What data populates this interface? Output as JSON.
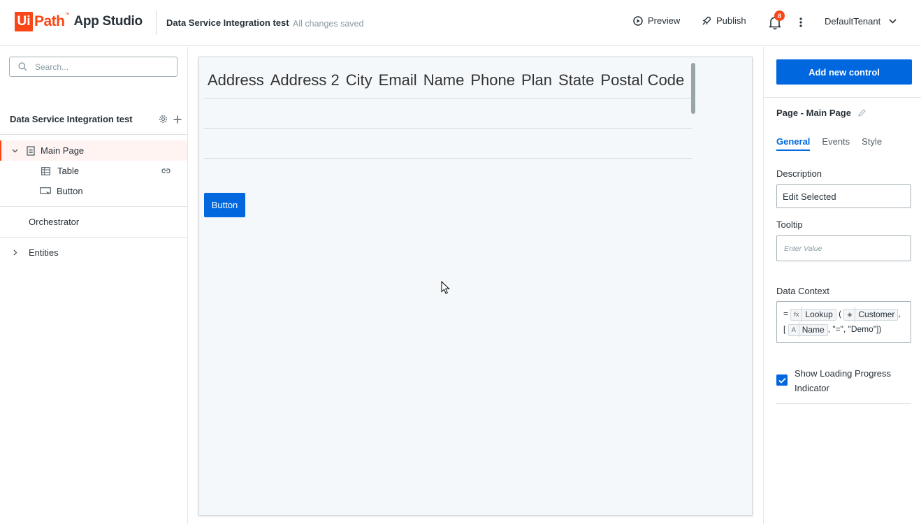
{
  "header": {
    "logo_ui": "Ui",
    "logo_path": "Path",
    "logo_tm": "™",
    "logo_app": "App Studio",
    "project_name": "Data Service Integration test",
    "save_status": "All changes saved",
    "preview_label": "Preview",
    "publish_label": "Publish",
    "notification_count": "8",
    "tenant": "DefaultTenant"
  },
  "left_panel": {
    "search_placeholder": "Search...",
    "tree_title": "Data Service Integration test",
    "items": [
      {
        "label": "Main Page",
        "icon": "page-icon",
        "selected": true
      },
      {
        "label": "Table",
        "icon": "table-icon"
      },
      {
        "label": "Button",
        "icon": "button-control-icon"
      }
    ],
    "orchestrator_label": "Orchestrator",
    "entities_label": "Entities"
  },
  "canvas": {
    "columns": [
      "Address",
      "Address 2",
      "City",
      "Email",
      "Name",
      "Phone",
      "Plan",
      "State",
      "Postal Code"
    ],
    "button_label": "Button"
  },
  "right_panel": {
    "add_control_label": "Add new control",
    "page_title": "Page - Main Page",
    "tabs": [
      "General",
      "Events",
      "Style"
    ],
    "active_tab": "General",
    "description_label": "Description",
    "description_value": "Edit Selected",
    "tooltip_label": "Tooltip",
    "tooltip_placeholder": "Enter Value",
    "data_context_label": "Data Context",
    "data_context": {
      "eq": "=",
      "lookup": "Lookup",
      "open_paren": "(",
      "entity": "Customer",
      "comma1": ",",
      "open_bracket": "[",
      "field": "Name",
      "rest": ", \"=\", \"Demo\"])"
    },
    "show_loading_label": "Show Loading Progress Indicator",
    "show_loading_checked": true
  },
  "colors": {
    "brand": "#fa4616",
    "accent": "#0067df"
  }
}
